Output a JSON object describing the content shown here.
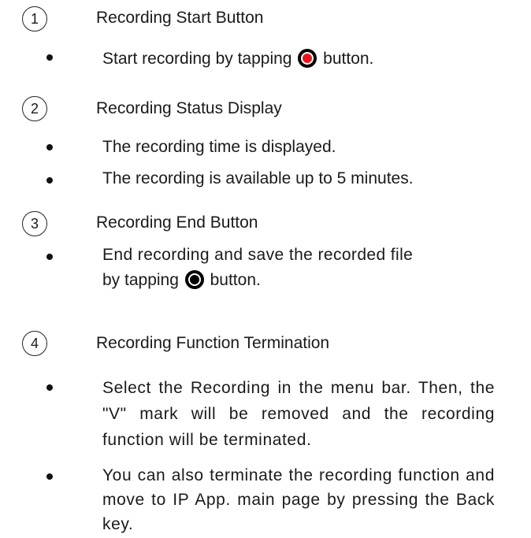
{
  "sections": [
    {
      "number": "1",
      "title": "Recording Start Button",
      "bullets": [
        {
          "before": "Start recording by tapping",
          "after": "button."
        }
      ]
    },
    {
      "number": "2",
      "title": "Recording Status Display",
      "bullets": [
        {
          "text": "The recording time is displayed."
        },
        {
          "text": "The recording is available up to 5 minutes."
        }
      ]
    },
    {
      "number": "3",
      "title": "Recording End Button",
      "bullets": [
        {
          "line1": "End recording and save the recorded file",
          "before": "by tapping",
          "after": "button."
        }
      ]
    },
    {
      "number": "4",
      "title": "Recording Function Termination",
      "bullets": [
        {
          "text": "Select the Recording in the menu bar. Then, the \"V\" mark will be removed and the recording function will be terminated."
        },
        {
          "text": "You can also terminate the recording function and move to IP App. main page by pressing the Back key."
        }
      ]
    }
  ],
  "icons": {
    "record": "record-button-icon",
    "stop": "stop-button-icon",
    "record_color": "#e8141c",
    "stop_color": "#000000"
  }
}
